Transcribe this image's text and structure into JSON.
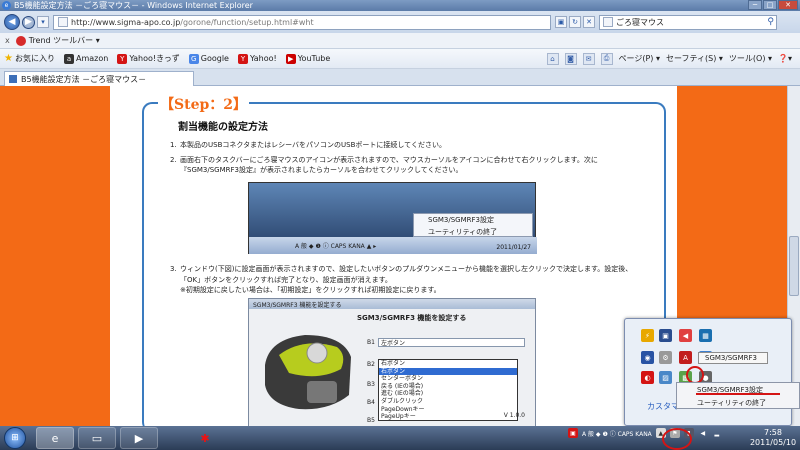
{
  "window": {
    "title": "B5機能設定方法 －ごろ寝マウス－ - Windows Internet Explorer",
    "min": "─",
    "max": "□",
    "close": "✕"
  },
  "address": {
    "url_host": "http://www.sigma-apo.co.jp",
    "url_path": "/gorone/function/setup.html#wht",
    "refresh": "↻",
    "stop": "✕",
    "search_placeholder": "ごろ寝マウス"
  },
  "trend": {
    "close": "x",
    "label": "Trend ツールバー ▾"
  },
  "favorites": {
    "label": "お気に入り",
    "items": [
      "Amazon",
      "Yahoo!きっず",
      "Google",
      "Yahoo!",
      "YouTube"
    ],
    "commands": [
      "ページ(P) ▾",
      "セーフティ(S) ▾",
      "ツール(O) ▾",
      "❓▾"
    ]
  },
  "tab": {
    "label": "B5機能設定方法 －ごろ寝マウス－"
  },
  "page": {
    "step": "【Step：2】",
    "heading": "割当機能の設定方法",
    "list": [
      {
        "num": "1.",
        "text": "本製品のUSBコネクタまたはレシーバをパソコンのUSBポートに接続してください。"
      },
      {
        "num": "2.",
        "text": "画面右下のタスクバーにごろ寝マウスのアイコンが表示されますので、マウスカーソルをアイコンに合わせて右クリックします。次に"
      },
      {
        "num": "",
        "text": "『SGM3/SGMRF3設定』が表示されましたらカーソルを合わせてクリックしてください。"
      },
      {
        "num": "3.",
        "text": "ウィンドウ(下図)に設定画面が表示されますので、設定したいボタンのプルダウンメニューから機能を選択し左クリックで決定します。設定後、"
      },
      {
        "num": "",
        "text": "「OK」ボタンをクリックすれば完了となり、設定画面が消えます。"
      },
      {
        "num": "",
        "text": "※初期設定に戻したい場合は、「初期設定」をクリックすれば初期設定に戻ります。"
      }
    ],
    "shot1": {
      "menu": [
        "SGM3/SGMRF3設定",
        "ユーティリティの終了"
      ],
      "tb_text": "A 般 ◆ ❶ ⓘ CAPS KANA ▲ ▸",
      "date": "2011/01/27"
    },
    "shot2": {
      "wtitle": "SGM3/SGMRF3 機能を設定する",
      "title": "SGM3/SGMRF3 機能を設定する",
      "rows": [
        {
          "label": "B1",
          "value": "左ボタン"
        },
        {
          "label": "B2",
          "value": "右ボタン"
        },
        {
          "label": "B3",
          "value": ""
        },
        {
          "label": "B4",
          "value": ""
        },
        {
          "label": "B5",
          "value": ""
        }
      ],
      "options": [
        "右ボタン",
        "右ボタン",
        "センターボタン",
        "戻る (IEの場合)",
        "進む (IEの場合)",
        "ダブルクリック",
        "PageDownキー",
        "PageUpキー"
      ],
      "version": "V 1.0.0"
    }
  },
  "tray_popup": {
    "customize": "カスタマ",
    "tooltip": "SGM3/SGMRF3",
    "context_menu": [
      "SGM3/SGMRF3設定",
      "ユーティリティの終了"
    ]
  },
  "taskbar": {
    "start": "⊞",
    "tray_text": "A 般 ◆ ❶ ⓘ CAPS KANA",
    "time": "7:58",
    "date": "2011/05/10"
  }
}
